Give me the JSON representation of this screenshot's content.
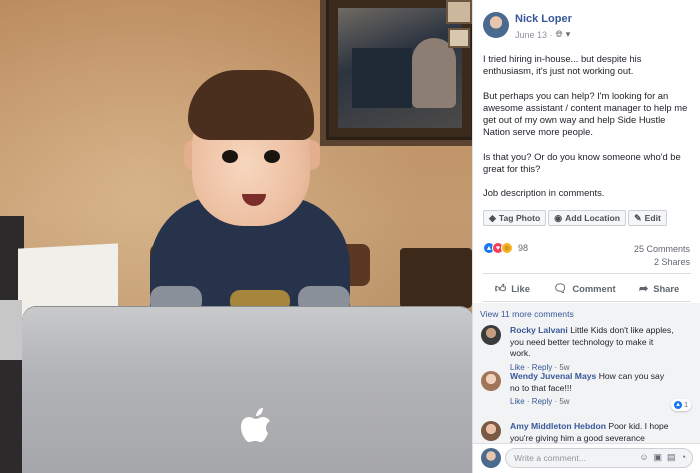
{
  "post": {
    "author": "Nick Loper",
    "date": "June 13 ·",
    "paragraphs": [
      "I tried hiring in-house... but despite his enthusiasm, it's just not working out.",
      "But perhaps you can help? I'm looking for an awesome assistant / content manager to help me get out of my own way and help Side Hustle Nation serve more people.",
      "Is that you? Or do you know someone who'd be great for this?",
      "Job description in comments."
    ]
  },
  "edit_bar": {
    "tag_photo": "Tag Photo",
    "add_location": "Add Location",
    "edit": "Edit"
  },
  "stats": {
    "reaction_count": "98",
    "comments": "25 Comments",
    "shares": "2 Shares"
  },
  "actions": {
    "like": "Like",
    "comment": "Comment",
    "share": "Share"
  },
  "comments_section": {
    "view_more": "View 11 more comments",
    "items": [
      {
        "name": "Rocky Lalvani",
        "text": "Little Kids don't like apples, you need better technology to make it work.",
        "like": "Like",
        "reply": "Reply",
        "time": "5w"
      },
      {
        "name": "Wendy Juvenal Mays",
        "text": "How can you say no to that face!!!",
        "like": "Like",
        "reply": "Reply",
        "time": "5w",
        "reactions": "1"
      },
      {
        "name": "Amy Middleton Hebdon",
        "text": "Poor kid. I hope you're giving him a good severance"
      }
    ]
  },
  "composer": {
    "placeholder": "Write a comment..."
  },
  "colors": {
    "link": "#385898",
    "like_blue": "#1877f2",
    "love_red": "#f33e58",
    "haha_yellow": "#f7b125"
  },
  "icons": [
    "globe-icon",
    "dropdown-caret-icon",
    "tag-icon",
    "location-pin-icon",
    "pencil-icon",
    "like-thumb-icon",
    "comment-bubble-icon",
    "share-arrow-icon",
    "emoji-icon",
    "camera-icon",
    "gif-icon",
    "sticker-icon"
  ]
}
